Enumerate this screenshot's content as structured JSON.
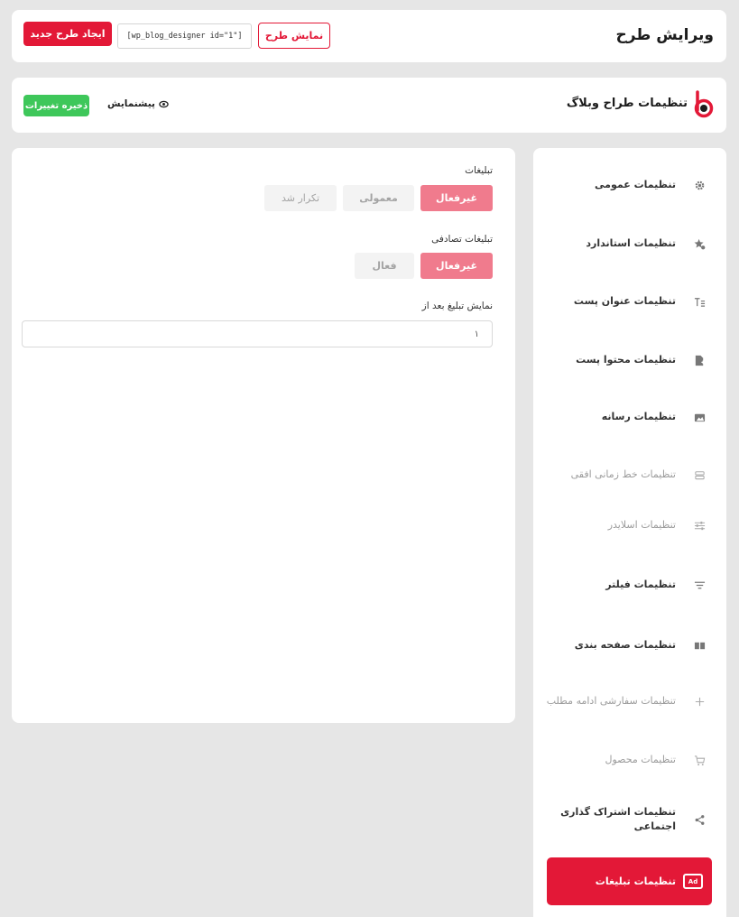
{
  "header": {
    "title": "ویرایش طرح",
    "new_design_label": "ایجاد طرح جدید",
    "shortcode": "[wp_blog_designer id=\"1\"]",
    "preview_design_label": "نمایش طرح"
  },
  "plugin_bar": {
    "name": "تنظیمات طراح وبلاگ",
    "preview_label": "پیشنمایش",
    "save_label": "ذخیره تغییرات"
  },
  "sidebar": {
    "items": [
      {
        "label": "تنظیمات عمومی",
        "icon": "gear-icon",
        "dim": false
      },
      {
        "label": "تنظیمات استاندارد",
        "icon": "star-settings-icon",
        "dim": false
      },
      {
        "label": "تنظیمات عنوان پست",
        "icon": "title-icon",
        "dim": false
      },
      {
        "label": "تنظیمات محتوا پست",
        "icon": "document-add-icon",
        "dim": false
      },
      {
        "label": "تنظیمات رسانه",
        "icon": "media-folder-icon",
        "dim": false
      },
      {
        "label": "تنظیمات خط زمانی افقی",
        "icon": "timeline-icon",
        "dim": true
      },
      {
        "label": "تنظیمات اسلایدر",
        "icon": "slider-icon",
        "dim": true
      },
      {
        "label": "تنظیمات فیلتر",
        "icon": "filter-icon",
        "dim": false
      },
      {
        "label": "تنظیمات صفحه بندی",
        "icon": "pagination-icon",
        "dim": false
      },
      {
        "label": "تنظیمات سفارشی ادامه مطلب",
        "icon": "plus-icon",
        "dim": true
      },
      {
        "label": "تنظیمات محصول",
        "icon": "cart-icon",
        "dim": true
      },
      {
        "label": "تنظیمات اشتراک گذاری\nاجتماعی",
        "icon": "share-icon",
        "dim": false
      }
    ],
    "active": {
      "label": "تنظیمات تبلیغات",
      "icon": "ad-icon",
      "badge": "Ad"
    }
  },
  "main": {
    "ads": {
      "label": "تبلیغات",
      "options": [
        "غیرفعال",
        "معمولی",
        "تکرار شد"
      ],
      "selected": "غیرفعال"
    },
    "random_ads": {
      "label": "تبلیغات تصادفی",
      "options": [
        "غیرفعال",
        "فعال"
      ],
      "selected": "غیرفعال"
    },
    "show_after": {
      "label": "نمایش تبلیغ بعد از",
      "value": "۱"
    }
  },
  "colors": {
    "accent": "#e31837",
    "accent_light": "#f07b8d",
    "save": "#3ec75a",
    "background": "#e6e6e6"
  }
}
